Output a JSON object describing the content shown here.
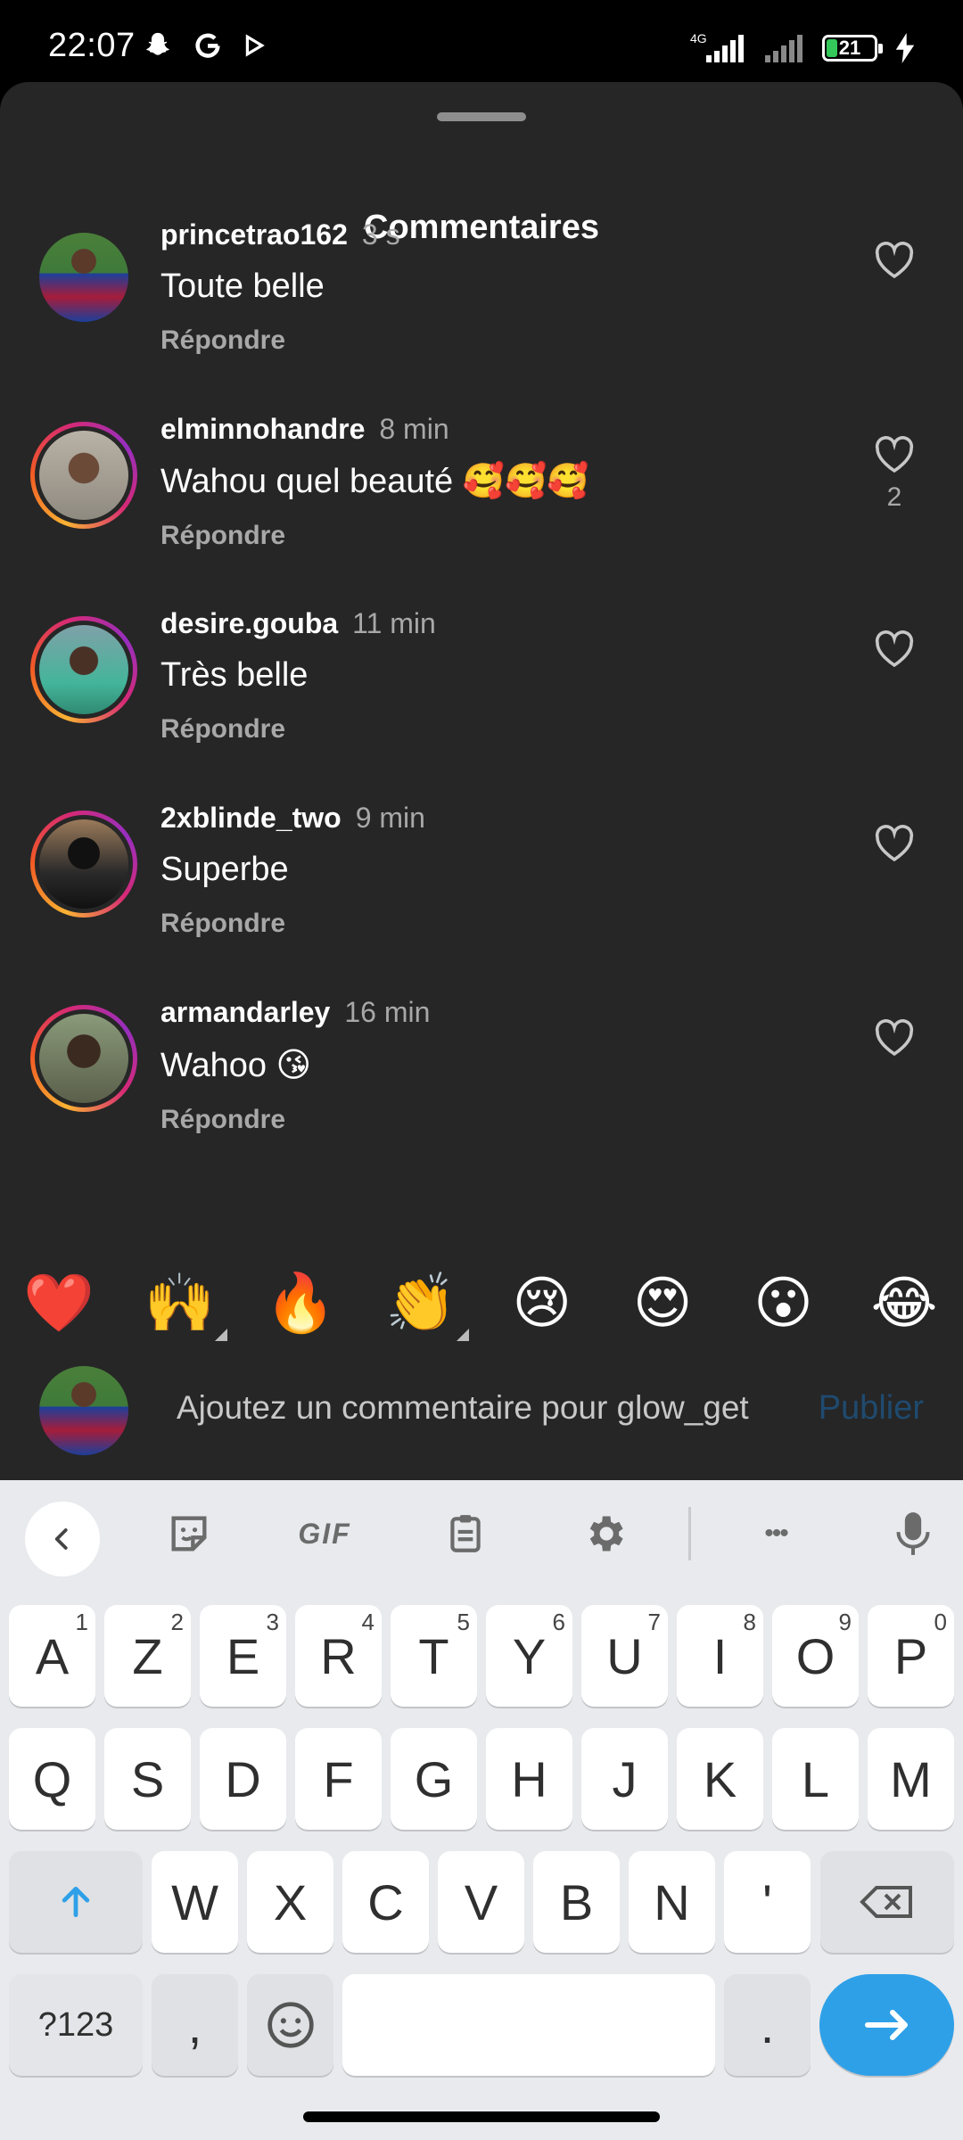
{
  "status_bar": {
    "time": "22:07",
    "left_icons": [
      "snapchat-icon",
      "google-icon",
      "play-icon"
    ],
    "network": "4G",
    "battery_level": "21",
    "battery_percent": 21
  },
  "sheet": {
    "title": "Commentaires"
  },
  "comments": [
    {
      "username": "princetrao162",
      "time": "3 s",
      "text": "Toute belle",
      "reply_label": "Répondre",
      "likes": "",
      "story_ring": false
    },
    {
      "username": "elminnohandre",
      "time": "8 min",
      "text": "Wahou quel beauté 🥰🥰🥰",
      "reply_label": "Répondre",
      "likes": "2",
      "story_ring": true
    },
    {
      "username": "desire.gouba",
      "time": "11 min",
      "text": "Très belle",
      "reply_label": "Répondre",
      "likes": "",
      "story_ring": true
    },
    {
      "username": "2xblinde_two",
      "time": "9 min",
      "text": "Superbe",
      "reply_label": "Répondre",
      "likes": "",
      "story_ring": true
    },
    {
      "username": "armandarley",
      "time": "16 min",
      "text": "Wahoo 😘",
      "reply_label": "Répondre",
      "likes": "",
      "story_ring": true
    }
  ],
  "emoji_bar": [
    "❤️",
    "🙌",
    "🔥",
    "👏",
    "😢",
    "😍",
    "😮",
    "😂"
  ],
  "composer": {
    "placeholder": "Ajoutez un commentaire pour glow_get",
    "publish_label": "Publier"
  },
  "keyboard": {
    "toolbar": {
      "gif_label": "GIF",
      "more_label": "•••"
    },
    "rows": [
      [
        {
          "k": "A",
          "s": "1"
        },
        {
          "k": "Z",
          "s": "2"
        },
        {
          "k": "E",
          "s": "3"
        },
        {
          "k": "R",
          "s": "4"
        },
        {
          "k": "T",
          "s": "5"
        },
        {
          "k": "Y",
          "s": "6"
        },
        {
          "k": "U",
          "s": "7"
        },
        {
          "k": "I",
          "s": "8"
        },
        {
          "k": "O",
          "s": "9"
        },
        {
          "k": "P",
          "s": "0"
        }
      ],
      [
        {
          "k": "Q"
        },
        {
          "k": "S"
        },
        {
          "k": "D"
        },
        {
          "k": "F"
        },
        {
          "k": "G"
        },
        {
          "k": "H"
        },
        {
          "k": "J"
        },
        {
          "k": "K"
        },
        {
          "k": "L"
        },
        {
          "k": "M"
        }
      ],
      [
        {
          "k": "W"
        },
        {
          "k": "X"
        },
        {
          "k": "C"
        },
        {
          "k": "V"
        },
        {
          "k": "B"
        },
        {
          "k": "N"
        },
        {
          "k": "'"
        }
      ]
    ],
    "symbols_label": "?123",
    "comma_label": ",",
    "period_label": "."
  },
  "colors": {
    "sheet_bg": "#262626",
    "publish_text": "#1f4a6f",
    "enter_key": "#2ea0e8"
  }
}
